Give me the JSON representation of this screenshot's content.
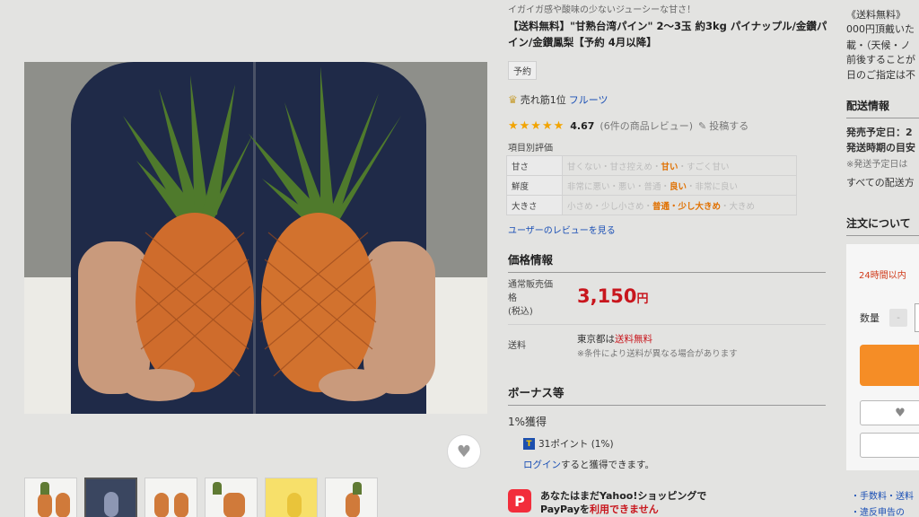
{
  "product": {
    "subtitle": "イガイガ感や酸味の少ないジューシーな甘さ！",
    "title": "【送料無料】\"甘熟台湾パイン\" 2〜3玉 約3kg パイナップル/金鑚パイン/金鑚鳳梨【予約 4月以降】",
    "badge": "予約",
    "rank_text": "売れ筋1位",
    "rank_category": "フルーツ",
    "rating": {
      "stars": "★★★★★",
      "score": "4.67",
      "reviews": "(6件の商品レビュー)",
      "post_label": "投稿する"
    },
    "item_eval_title": "項目別評価",
    "eval_rows": [
      {
        "label": "甘さ",
        "before": "甘くない・甘さ控えめ・",
        "hl": "甘い",
        "after": "・すごく甘い"
      },
      {
        "label": "鮮度",
        "before": "非常に悪い・悪い・普通・",
        "hl": "良い",
        "after": "・非常に良い"
      },
      {
        "label": "大きさ",
        "before": "小さめ・少し小さめ・",
        "hl": "普通・少し大きめ",
        "after": "・大きめ"
      }
    ],
    "user_reviews_link": "ユーザーのレビューを見る",
    "price_section": "価格情報",
    "price_label_1": "通常販売価",
    "price_label_2": "格",
    "price_label_3": "(税込)",
    "price_value": "3,150",
    "price_unit": "円",
    "shipping_label": "送料",
    "shipping_pre": "東京都は",
    "shipping_free": "送料無料",
    "shipping_note": "※条件により送料が異なる場合があります",
    "bonus_section": "ボーナス等",
    "bonus_pct": "1%獲得",
    "points_text": "31ポイント (1%)",
    "login_link": "ログイン",
    "login_rest": "すると獲得できます。",
    "paypay_line1": "あなたはまだYahoo!ショッピングで",
    "paypay_line2_pre": "PayPayを",
    "paypay_line2_red": "利用できません"
  },
  "right": {
    "free_ship_top": "《送料無料》",
    "free_ship_2": "000円頂戴いた",
    "free_ship_3": "載・（天候・ノ",
    "free_ship_4": "前後することが",
    "free_ship_5": "日のご指定は不",
    "delivery_h": "配送情報",
    "delivery_1": "発売予定日：2",
    "delivery_2": "発送時期の目安",
    "delivery_3": "※発送予定日は",
    "delivery_link": "すべての配送方",
    "order_h": "注文について",
    "hours24": "24時間以内",
    "qty_label": "数量",
    "qty_minus": "-",
    "link_fee": "・手数料・送料",
    "link_report": "・違反申告の"
  },
  "icons": {
    "heart": "♥",
    "crown": "♛",
    "pencil": "✎",
    "t_point": "T",
    "paypay": "P"
  }
}
